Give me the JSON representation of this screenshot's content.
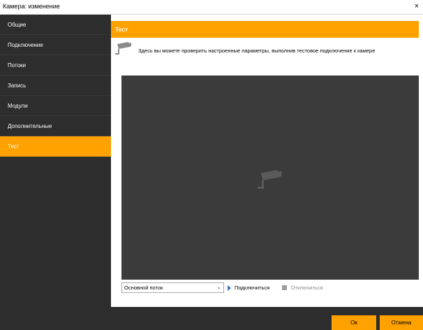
{
  "window": {
    "title": "Камера: изменение",
    "close_glyph": "×"
  },
  "sidebar": {
    "items": [
      {
        "label": "Общие"
      },
      {
        "label": "Подключение"
      },
      {
        "label": "Потоки"
      },
      {
        "label": "Запись"
      },
      {
        "label": "Модули"
      },
      {
        "label": "Дополнительные"
      },
      {
        "label": "Тест"
      }
    ],
    "active_index": 6
  },
  "content": {
    "header": "Тест",
    "info_text": "Здесь вы можете проверить настроенные параметры, выполнив тестовое подключение к камере",
    "info_icon": "camera-icon",
    "stream_select": {
      "value": "Основной поток",
      "arrow": "⌄"
    },
    "connect_label": "Подключиться",
    "disconnect_label": "Отключиться"
  },
  "footer": {
    "ok_label": "Ок",
    "cancel_label": "Отмена"
  },
  "colors": {
    "accent": "#ffa200",
    "sidebar_bg": "#2d2d2d",
    "video_bg": "#3b3b3b",
    "play": "#2f78c7"
  }
}
